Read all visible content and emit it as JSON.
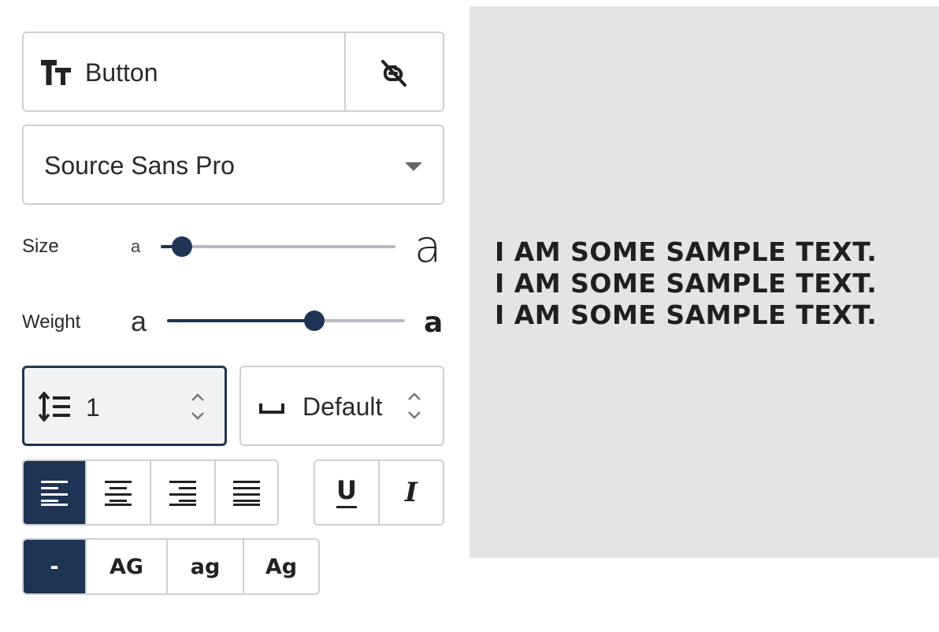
{
  "text_style": {
    "label": "Button",
    "icon": "text-size-icon",
    "unlink_icon": "unlink-icon"
  },
  "font": {
    "selected": "Source Sans Pro"
  },
  "size": {
    "label": "Size",
    "min_glyph": "a",
    "max_glyph": "a",
    "value_fraction": 0.09
  },
  "weight": {
    "label": "Weight",
    "min_glyph": "a",
    "max_glyph": "a",
    "value_fraction": 0.62
  },
  "line_height": {
    "value": "1",
    "icon": "line-height-icon"
  },
  "letter_spacing": {
    "value": "Default",
    "icon": "space-icon"
  },
  "alignment": {
    "options": [
      "align-left",
      "align-center",
      "align-right",
      "align-justify"
    ],
    "selected": "align-left"
  },
  "decoration": {
    "options": [
      "underline",
      "italic"
    ],
    "underline_glyph": "U",
    "italic_glyph": "I"
  },
  "text_case": {
    "options": [
      "-",
      "AG",
      "ag",
      "Ag"
    ],
    "selected": "-"
  },
  "preview": {
    "lines": [
      "I AM SOME SAMPLE TEXT.",
      "I AM SOME SAMPLE TEXT.",
      "I AM SOME SAMPLE TEXT."
    ]
  },
  "colors": {
    "accent": "#1f3455",
    "border": "#cfcfcf",
    "preview_bg": "#e4e4e4"
  }
}
